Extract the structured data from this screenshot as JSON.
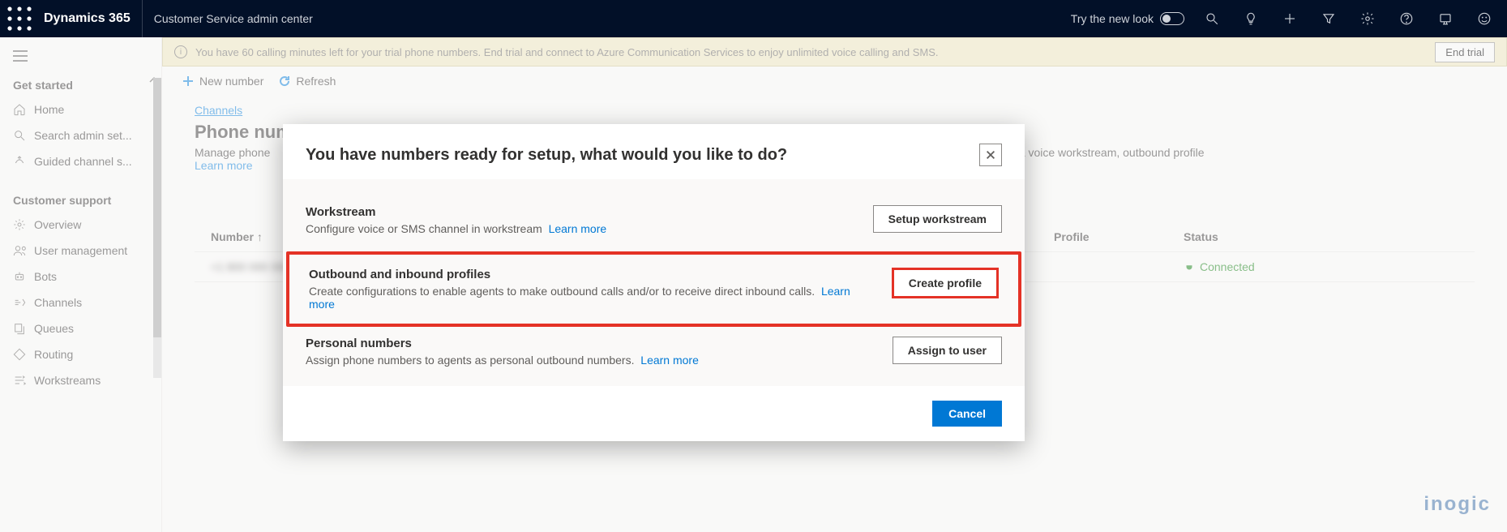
{
  "header": {
    "brand": "Dynamics 365",
    "app": "Customer Service admin center",
    "try_new": "Try the new look"
  },
  "banner": {
    "text": "You have 60 calling minutes left for your trial phone numbers. End trial and connect to Azure Communication Services to enjoy unlimited voice calling and SMS.",
    "end_trial": "End trial"
  },
  "toolbar": {
    "new_number": "New number",
    "refresh": "Refresh"
  },
  "sidebar": {
    "group1": "Get started",
    "items1": [
      "Home",
      "Search admin set...",
      "Guided channel s..."
    ],
    "group2": "Customer support",
    "items2": [
      "Overview",
      "User management",
      "Bots",
      "Channels",
      "Queues",
      "Routing",
      "Workstreams"
    ]
  },
  "page": {
    "breadcrumb": "Channels",
    "title": "Phone num",
    "desc_prefix": "Manage phone ",
    "desc_suffix": "to a voice workstream, outbound profile",
    "learn_more": "Learn more"
  },
  "table": {
    "col_number": "Number",
    "col_profile": "Profile",
    "col_status": "Status",
    "row_number": "+1 800 000 0000",
    "row_status": "Connected"
  },
  "modal": {
    "title": "You have numbers ready for setup, what would you like to do?",
    "opt1_title": "Workstream",
    "opt1_desc": "Configure voice or SMS channel in workstream",
    "opt1_btn": "Setup workstream",
    "opt2_title": "Outbound and inbound profiles",
    "opt2_desc": "Create configurations to enable agents to make outbound calls and/or to receive direct inbound calls.",
    "opt2_btn": "Create profile",
    "opt3_title": "Personal numbers",
    "opt3_desc": "Assign phone numbers to agents as personal outbound numbers.",
    "opt3_btn": "Assign to user",
    "learn_more": "Learn more",
    "cancel": "Cancel"
  },
  "watermark": "inogic"
}
